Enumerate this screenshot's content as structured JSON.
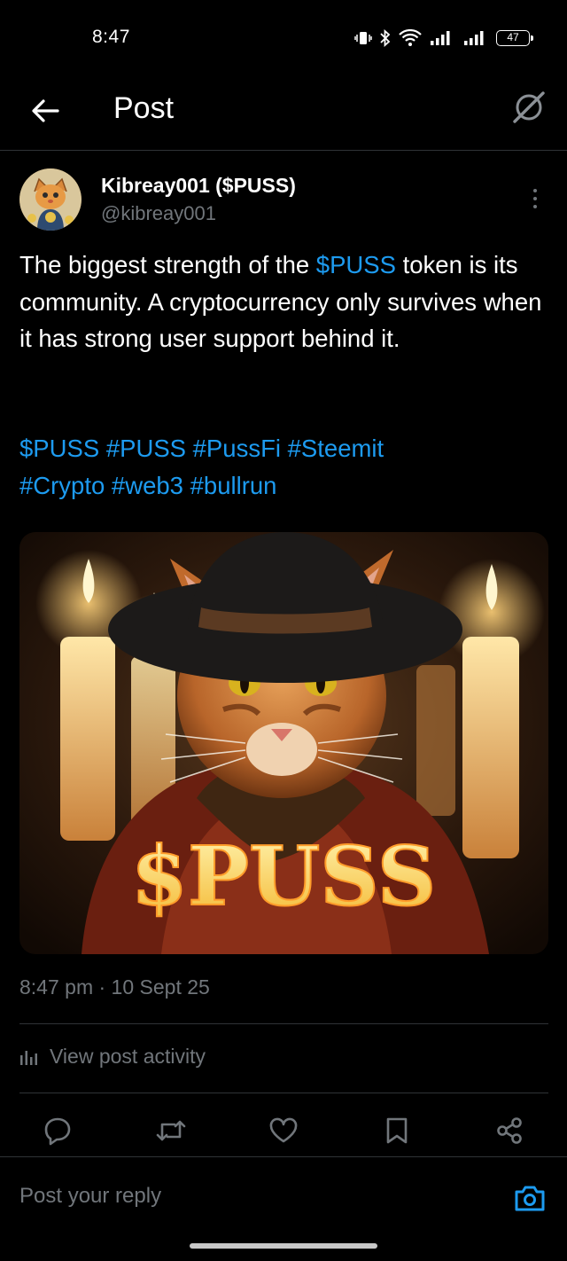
{
  "status_bar": {
    "time": "8:47",
    "battery": "47"
  },
  "header": {
    "title": "Post"
  },
  "author": {
    "display_name": "Kibreay001 ($PUSS)",
    "handle": "@kibreay001"
  },
  "post": {
    "text_before": "The biggest strength of the ",
    "cashtag": "$PUSS",
    "text_after": " token is its community. A cryptocurrency only survives when it has strong user support behind it.",
    "hashtags_line1": "$PUSS #PUSS #PussFi #Steemit",
    "hashtags_line2": "#Crypto #web3 #bullrun",
    "image_text": "$PUSS",
    "timestamp": "8:47 pm · 10 Sept 25"
  },
  "activity": {
    "label": "View post activity"
  },
  "actions": [
    "reply-icon",
    "repost-icon",
    "like-icon",
    "bookmark-icon",
    "share-icon"
  ],
  "reply_bar": {
    "placeholder": "Post your reply"
  },
  "colors": {
    "background": "#000000",
    "link": "#1d9bf0",
    "secondary_text": "#71767b",
    "divider": "#2f3336"
  }
}
